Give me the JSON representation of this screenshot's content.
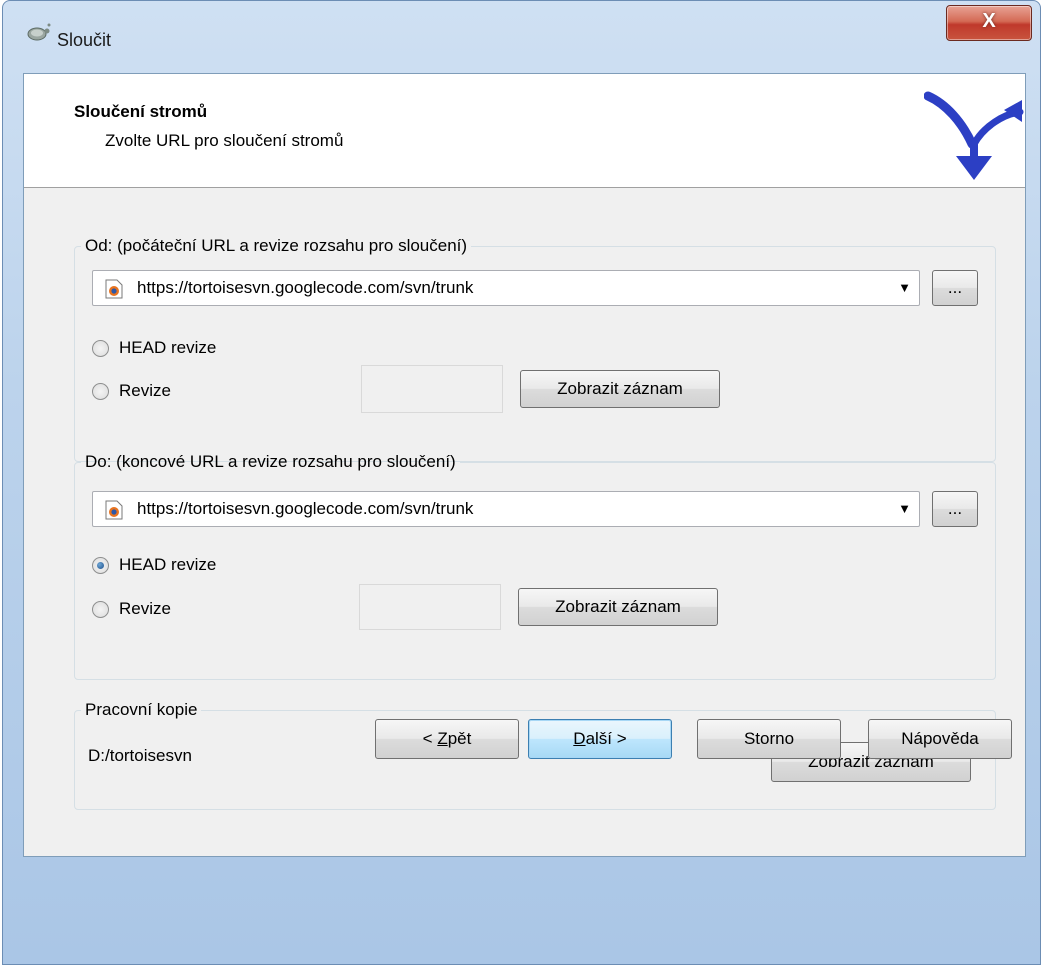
{
  "window": {
    "title": "Sloučit",
    "close_label": "X"
  },
  "header": {
    "title": "Sloučení stromů",
    "subtitle": "Zvolte URL pro sloučení stromů",
    "icon": "merge-arrows-icon"
  },
  "from_group": {
    "legend": "Od: (počáteční URL a revize rozsahu pro sloučení)",
    "url": "https://tortoisesvn.googlecode.com/svn/trunk",
    "browse_label": "...",
    "head_label": "HEAD revize",
    "revision_label": "Revize",
    "revision_value": "",
    "selected": "none",
    "show_log_label": "Zobrazit záznam"
  },
  "to_group": {
    "legend": "Do: (koncové URL a revize rozsahu pro sloučení)",
    "url": "https://tortoisesvn.googlecode.com/svn/trunk",
    "browse_label": "...",
    "head_label": "HEAD revize",
    "revision_label": "Revize",
    "revision_value": "",
    "selected": "head",
    "show_log_label": "Zobrazit záznam"
  },
  "working_copy": {
    "legend": "Pracovní kopie",
    "path": "D:/tortoisesvn",
    "show_log_label": "Zobrazit záznam"
  },
  "footer": {
    "back_prefix": "< ",
    "back_mnemonic": "Z",
    "back_rest": "pět",
    "next_mnemonic": "D",
    "next_rest": "alší >",
    "cancel_label": "Storno",
    "help_label": "Nápověda"
  },
  "colors": {
    "accent": "#3c7fb1",
    "close_button": "#c0392b",
    "merge_icon": "#2c3fc4"
  }
}
